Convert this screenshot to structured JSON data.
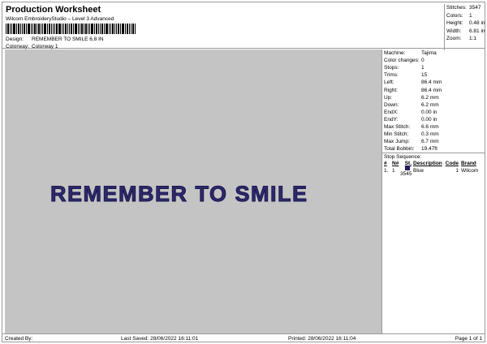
{
  "header": {
    "title": "Production Worksheet",
    "subtitle": "Wilcom EmbroideryStudio – Level 3 Advanced",
    "design_label": "Design:",
    "design_value": "REMEMBER TO SMILE 6,8 IN",
    "colorway_label": "Colorway:",
    "colorway_value": "Colorway 1"
  },
  "stats": [
    {
      "k": "Stitches:",
      "v": "3547"
    },
    {
      "k": "Colors:",
      "v": "1"
    },
    {
      "k": "Height:",
      "v": "0.48 in"
    },
    {
      "k": "Width:",
      "v": "6.81 in"
    },
    {
      "k": "Zoom:",
      "v": "1:1"
    }
  ],
  "preview": {
    "design_text": "REMEMBER TO SMILE"
  },
  "machine_info": [
    {
      "k": "Machine:",
      "v": "Tajima"
    },
    {
      "k": "Color changes:",
      "v": "0"
    },
    {
      "k": "Stops:",
      "v": "1"
    },
    {
      "k": "Trims:",
      "v": "15"
    },
    {
      "k": "Left:",
      "v": "86.4 mm"
    },
    {
      "k": "Right:",
      "v": "86.4 mm"
    },
    {
      "k": "Up:",
      "v": "6.2 mm"
    },
    {
      "k": "Down:",
      "v": "6.2 mm"
    },
    {
      "k": "EndX:",
      "v": "0.00 in"
    },
    {
      "k": "EndY:",
      "v": "0.00 in"
    },
    {
      "k": "Max Stitch:",
      "v": "6.6 mm"
    },
    {
      "k": "Min Stitch:",
      "v": "0.3 mm"
    },
    {
      "k": "Max Jump:",
      "v": "6.7 mm"
    },
    {
      "k": "Total Bobbin:",
      "v": "19.47ft"
    }
  ],
  "stop_sequence": {
    "title": "Stop Sequence:",
    "headers": [
      "#",
      "N#",
      "St.",
      "Description",
      "Code",
      "Brand"
    ],
    "rows": [
      {
        "num": "1.",
        "n": "1",
        "st": "3545",
        "desc": "Blue",
        "code": "1",
        "brand": "Wilcom",
        "color": "#1f1c60"
      }
    ]
  },
  "footer": {
    "created": "Created By:",
    "last_saved": "Last Saved: 28/06/2022 16:11:01",
    "printed": "Printed: 28/06/2022 16:11:04",
    "page": "Page 1 of 1"
  }
}
